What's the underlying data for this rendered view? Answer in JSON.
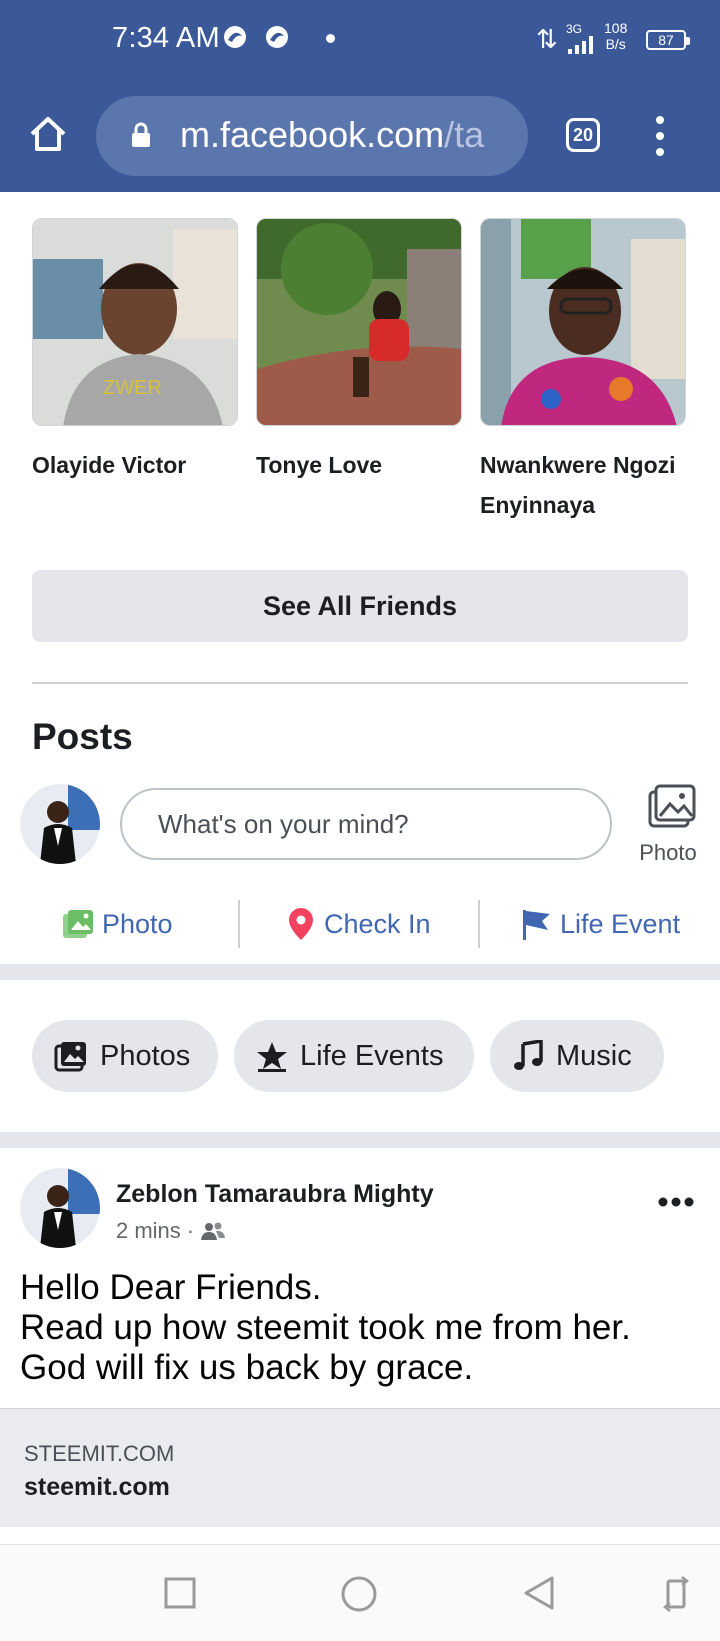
{
  "status_bar": {
    "time": "7:34 AM",
    "network_type": "3G",
    "speed_value": "108",
    "speed_unit": "B/s",
    "battery": "87"
  },
  "browser": {
    "url_domain": "m.facebook.com",
    "url_path": "/ta",
    "tab_count": "20"
  },
  "friends": {
    "items": [
      {
        "name_line1": "Olayide Victor",
        "name_line2": ""
      },
      {
        "name_line1": "Tonye Love",
        "name_line2": ""
      },
      {
        "name_line1": "Nwankwere Ngozi",
        "name_line2": "Enyinnaya"
      }
    ],
    "see_all_label": "See All Friends"
  },
  "posts": {
    "title": "Posts",
    "composer_placeholder": "What's on your mind?",
    "side_photo_label": "Photo",
    "actions": [
      {
        "label": "Photo",
        "icon": "photo-icon",
        "color": "#6bbe66"
      },
      {
        "label": "Check In",
        "icon": "location-pin-icon",
        "color": "#f3425f"
      },
      {
        "label": "Life Event",
        "icon": "flag-icon",
        "color": "#4267b2"
      }
    ]
  },
  "filter_chips": [
    {
      "label": "Photos",
      "icon": "photos-icon"
    },
    {
      "label": "Life Events",
      "icon": "star-icon"
    },
    {
      "label": "Music",
      "icon": "music-note-icon"
    }
  ],
  "post": {
    "author": "Zeblon Tamaraubra Mighty",
    "time": "2 mins",
    "audience_icon": "friends-icon",
    "text": "Hello Dear Friends.\nRead up how steemit took me from her.\nGod will fix us back by grace.",
    "link_domain": "STEEMIT.COM",
    "link_title": "steemit.com"
  },
  "colors": {
    "header_blue": "#3b5998",
    "link_blue": "#4267b2",
    "chip_gray": "#e4e6eb"
  }
}
